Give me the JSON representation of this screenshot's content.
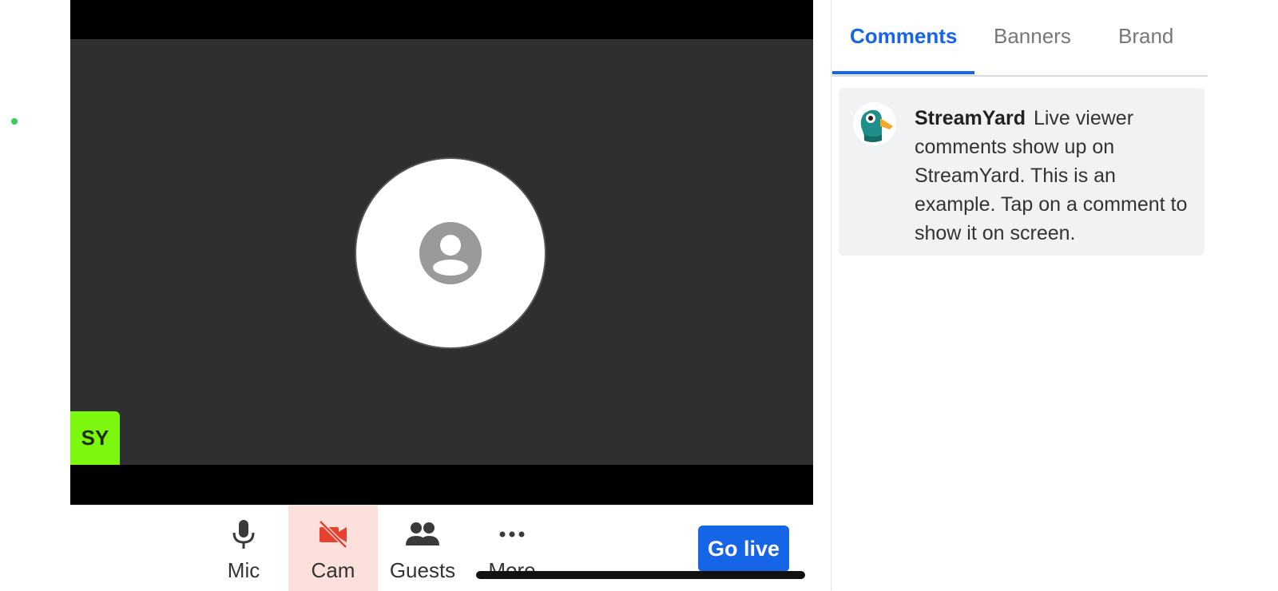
{
  "stage": {
    "participant_initials": "SY"
  },
  "toolbar": {
    "mic_label": "Mic",
    "cam_label": "Cam",
    "guests_label": "Guests",
    "more_label": "More",
    "go_live_label": "Go live"
  },
  "sidebar": {
    "tabs": [
      {
        "label": "Comments",
        "active": true
      },
      {
        "label": "Banners",
        "active": false
      },
      {
        "label": "Brand",
        "active": false
      }
    ],
    "comments": [
      {
        "author": "StreamYard",
        "text": "Live viewer comments show up on StreamYard. This is an example. Tap on a comment to show it on screen."
      }
    ]
  },
  "colors": {
    "accent": "#1565e6",
    "name_tag": "#7cf80f",
    "cam_off": "#e8412f",
    "video_bg": "#2f2f31"
  }
}
